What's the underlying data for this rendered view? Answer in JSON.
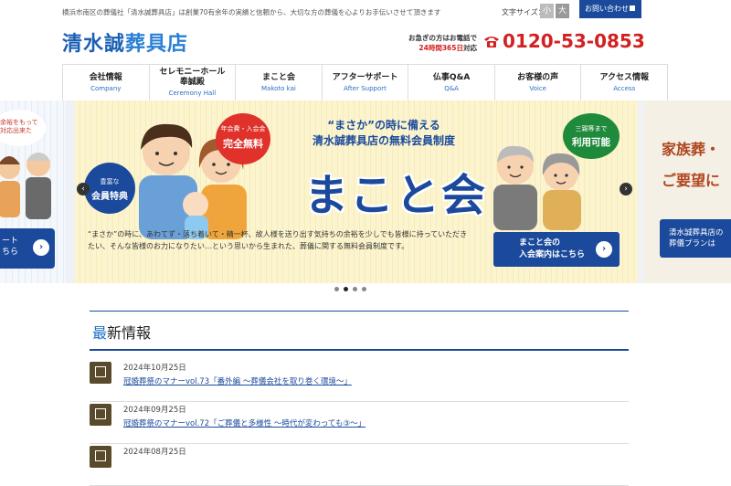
{
  "top": {
    "description": "横浜市南区の葬儀社「清水誠葬具店」は創業70有余年の実績と信頼から、大切な方の葬儀を心よりお手伝いさせて頂きます",
    "font_size_label": "文字サイズ：",
    "font_small": "小",
    "font_large": "大",
    "contact": "お問い合わせ"
  },
  "header": {
    "logo_main": "清水誠",
    "logo_tail": "葬具店",
    "note_line1": "お急ぎの方はお電話で",
    "note_hours": "24時間365日",
    "note_suffix": "対応",
    "phone": "0120-53-0853"
  },
  "nav": [
    {
      "jp": "会社情報",
      "en": "Company"
    },
    {
      "jp": "セレモニーホール\n奉誠殿",
      "en": "Ceremony Hall"
    },
    {
      "jp": "まこと会",
      "en": "Makoto kai"
    },
    {
      "jp": "アフターサポート",
      "en": "After Support"
    },
    {
      "jp": "仏事Q&A",
      "en": "Q&A"
    },
    {
      "jp": "お客様の声",
      "en": "Voice"
    },
    {
      "jp": "アクセス情報",
      "en": "Access"
    }
  ],
  "slider": {
    "left_bubble": "余裕をもって\n対応出来た",
    "left_btn": "ート\nちら",
    "badge_red_small": "年会費・入会金",
    "badge_red_big": "完全無料",
    "badge_blue_small": "豊富な",
    "badge_blue_big": "会員特典",
    "badge_green_small": "三親等まで",
    "badge_green_big": "利用可能",
    "headline1": "“まさか”の時に備える",
    "headline2": "清水誠葬具店の無料会員制度",
    "title": "まこと会",
    "desc": "“まさか”の時に、あわてず・落ち着いて・精一杯、故人様を送り出す気持ちの余裕を少しでも皆様に持っていただきたい、そんな皆様のお力になりたい…という思いから生まれた、葬儀に関する無料会員制度です。",
    "btn": "まこと会の\n入会案内はこちら",
    "right_t1": "家族葬・",
    "right_t2": "ご要望に",
    "right_btn": "清水誠葬具店の\n葬儀プランは",
    "prev": "‹",
    "next": "›"
  },
  "news": {
    "title_first": "最",
    "title_rest": "新情報",
    "items": [
      {
        "date": "2024年10月25日",
        "title": "冠婚葬祭のマナーvol.73「番外編 〜葬儀会社を取り巻く環境〜」"
      },
      {
        "date": "2024年09月25日",
        "title": "冠婚葬祭のマナーvol.72「ご葬儀と多様性 〜時代が変わっても③〜」"
      },
      {
        "date": "2024年08月25日",
        "title": ""
      }
    ]
  },
  "colors": {
    "brand_blue": "#1b4a9c",
    "accent_red": "#d32020",
    "slide_bg": "#fbf4cf"
  }
}
